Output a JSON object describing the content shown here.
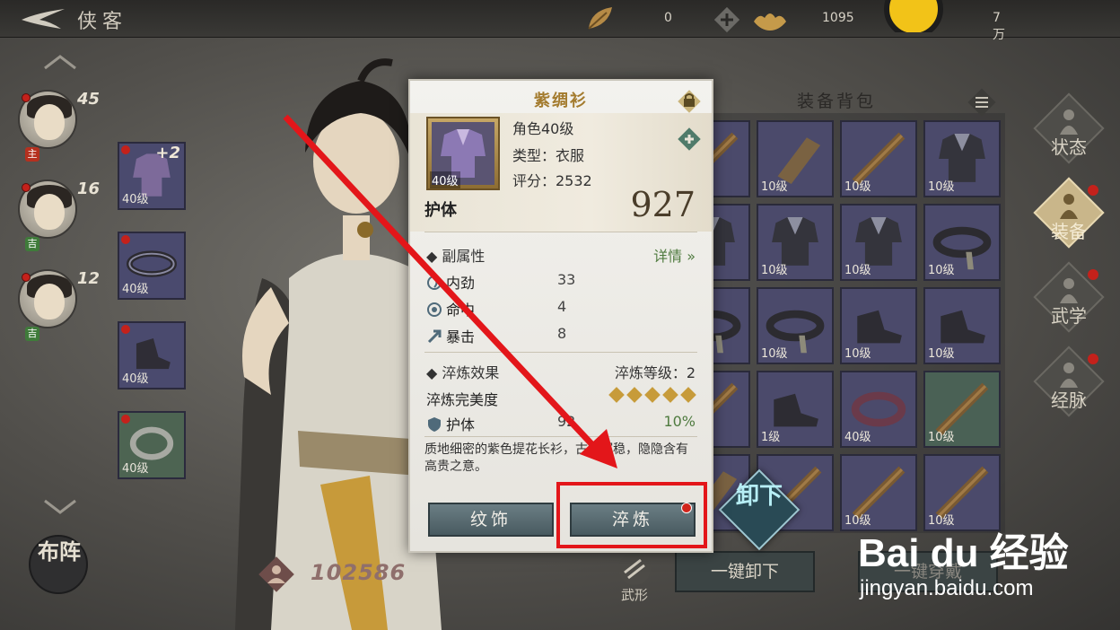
{
  "topbar": {
    "title": "侠客",
    "resources": [
      {
        "name": "leaf-currency",
        "value": "0"
      },
      {
        "name": "ingot-currency",
        "value": "1095"
      },
      {
        "name": "coin-currency",
        "value": "7万"
      }
    ]
  },
  "characters": [
    {
      "level": "45",
      "tag": "主",
      "tag_color": "#b5301f"
    },
    {
      "level": "16",
      "tag": "吉",
      "tag_color": "#3f7b3a"
    },
    {
      "level": "12",
      "tag": "吉",
      "tag_color": "#3f7b3a"
    }
  ],
  "equipped_slots": [
    {
      "level": "40级",
      "plus": "+2",
      "color": "purple",
      "icon": "robe-icon"
    },
    {
      "level": "40级",
      "plus": "",
      "color": "purple",
      "icon": "belt-icon"
    },
    {
      "level": "40级",
      "plus": "",
      "color": "purple",
      "icon": "boots-icon"
    },
    {
      "level": "40级",
      "plus": "",
      "color": "green",
      "icon": "bracelet-icon"
    }
  ],
  "bag": {
    "title": "装备背包",
    "items": [
      {
        "level": "",
        "color": "purple",
        "icon": "staff-icon"
      },
      {
        "level": "10级",
        "color": "purple",
        "icon": "bracer-icon"
      },
      {
        "level": "10级",
        "color": "purple",
        "icon": "staff-icon"
      },
      {
        "level": "10级",
        "color": "purple",
        "icon": "robe-icon"
      },
      {
        "level": "",
        "color": "purple",
        "icon": "robe-icon"
      },
      {
        "level": "10级",
        "color": "purple",
        "icon": "robe-icon"
      },
      {
        "level": "10级",
        "color": "purple",
        "icon": "robe-icon"
      },
      {
        "level": "10级",
        "color": "purple",
        "icon": "belt-icon"
      },
      {
        "level": "",
        "color": "purple",
        "icon": "belt-icon"
      },
      {
        "level": "10级",
        "color": "purple",
        "icon": "belt-icon"
      },
      {
        "level": "10级",
        "color": "purple",
        "icon": "boots-icon"
      },
      {
        "level": "10级",
        "color": "purple",
        "icon": "boots-icon"
      },
      {
        "level": "",
        "color": "purple",
        "icon": "staff-icon"
      },
      {
        "level": "1级",
        "color": "purple",
        "icon": "boots-icon"
      },
      {
        "level": "40级",
        "color": "purple",
        "icon": "bracelet-icon"
      },
      {
        "level": "10级",
        "color": "green",
        "icon": "staff-icon"
      },
      {
        "level": "",
        "color": "purple",
        "icon": "bracer-icon"
      },
      {
        "level": "",
        "color": "purple",
        "icon": "staff-icon"
      },
      {
        "level": "10级",
        "color": "purple",
        "icon": "staff-icon"
      },
      {
        "level": "10级",
        "color": "purple",
        "icon": "staff-icon"
      }
    ]
  },
  "right_nav": [
    {
      "label": "状态",
      "active": false,
      "dot": false
    },
    {
      "label": "装备",
      "active": true,
      "dot": true
    },
    {
      "label": "武学",
      "active": false,
      "dot": true
    },
    {
      "label": "经脉",
      "active": false,
      "dot": true
    }
  ],
  "bottom": {
    "formation_label": "布阵",
    "power": "102586",
    "wuxing_label": "武形",
    "unequip_all": "一键卸下",
    "equip_all": "一键穿戴",
    "unequip": "卸下"
  },
  "item_detail": {
    "name": "紫绸衫",
    "icon_level": "40级",
    "requirement": "角色40级",
    "type": "类型：衣服",
    "score": "评分：2532",
    "main_stat_name": "护体",
    "main_stat_value": "927",
    "sub_attr_title": "副属性",
    "detail_link": "详情",
    "sub_attrs": [
      {
        "name": "内劲",
        "value": "33",
        "icon": "swirl-icon"
      },
      {
        "name": "命中",
        "value": "4",
        "icon": "target-icon"
      },
      {
        "name": "暴击",
        "value": "8",
        "icon": "crit-icon"
      }
    ],
    "refine_title": "淬炼效果",
    "refine_level": "淬炼等级：2",
    "perfection_label": "淬炼完美度",
    "perfection_stars": 5,
    "refine_stat_name": "护体",
    "refine_stat_value": "92",
    "refine_stat_pct": "10%",
    "description": "质地细密的紫色提花长衫，古朴沉稳，隐隐含有高贵之意。",
    "btn_ornament": "纹饰",
    "btn_refine": "淬炼"
  },
  "watermark": {
    "main": "Bai du 经验",
    "sub": "jingyan.baidu.com"
  },
  "colors": {
    "purple_slot": "#4b4a6b",
    "green_slot": "#4a6155",
    "accent_gold": "#a37b2e",
    "annotation_red": "#e3161a"
  }
}
